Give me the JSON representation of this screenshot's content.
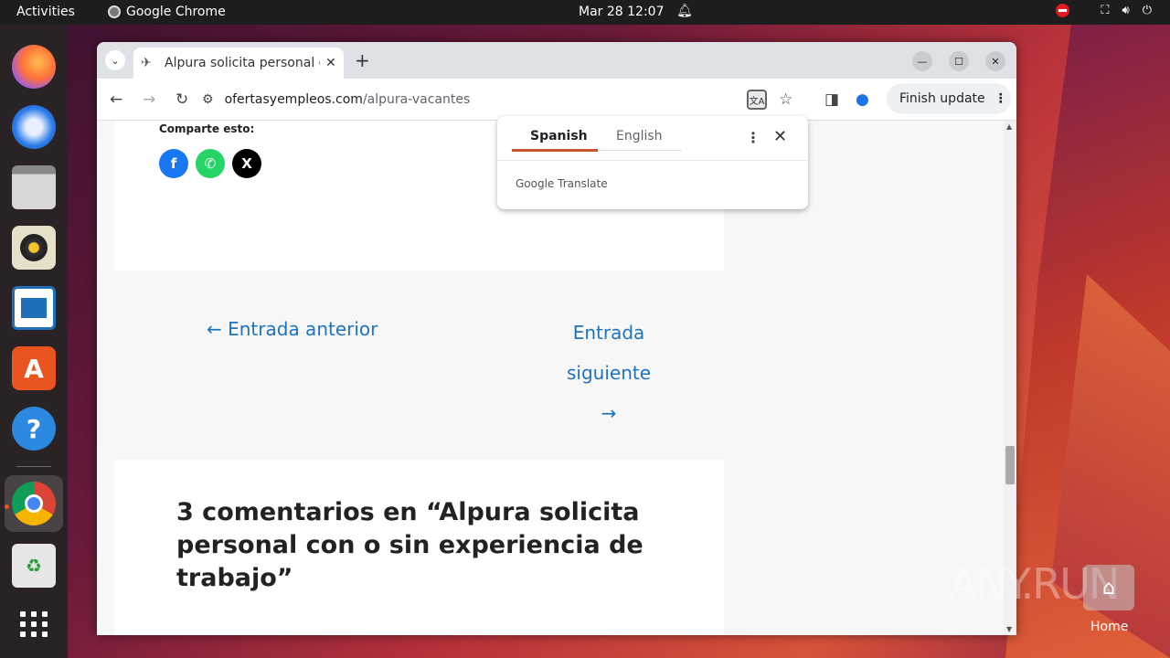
{
  "topbar": {
    "activities": "Activities",
    "app_name": "Google Chrome",
    "clock": "Mar 28  12:07"
  },
  "dock": {
    "items": [
      "firefox-icon",
      "thunderbird-icon",
      "files-icon",
      "rhythmbox-icon",
      "writer-icon",
      "app-center-icon",
      "help-icon",
      "chrome-icon",
      "trash-icon",
      "show-apps-icon"
    ]
  },
  "browser": {
    "tab_title": "Alpura solicita personal c",
    "url_domain": "ofertasyempleos.com",
    "url_path": "/alpura-vacantes",
    "finish_update": "Finish update"
  },
  "translate": {
    "lang_source": "Spanish",
    "lang_target": "English",
    "footer": "Google Translate",
    "accent": "#c5592c"
  },
  "page": {
    "share_label": "Comparte esto:",
    "prev_link": "← Entrada anterior",
    "next_link_1": "Entrada",
    "next_link_2": "siguiente",
    "next_arrow": "→",
    "comments_title": "3 comentarios en “Alpura solicita personal con o sin experiencia de trabajo”",
    "link_color": "#1e73be"
  },
  "desktop": {
    "watermark": "ANY.RUN",
    "home_label": "Home"
  }
}
